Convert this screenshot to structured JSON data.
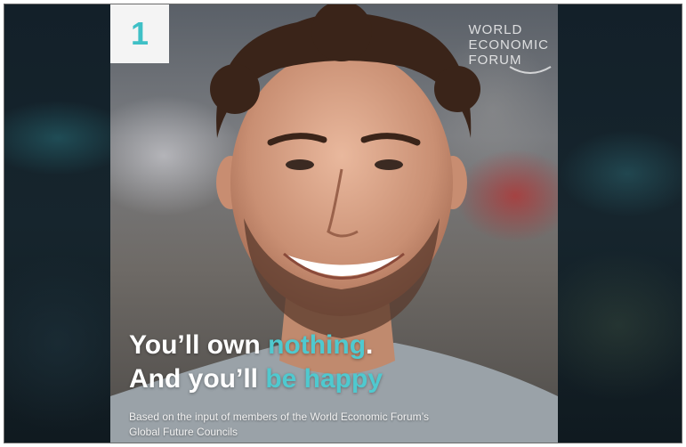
{
  "badge": {
    "number": "1"
  },
  "logo": {
    "line1": "WORLD",
    "line2": "ECONOMIC",
    "line3": "FORUM"
  },
  "headline": {
    "line1_part1": "You’ll own ",
    "line1_accent": "nothing",
    "line1_end": ".",
    "line2_part1": "And you’ll ",
    "line2_accent": "be happy"
  },
  "caption": {
    "line1": "Based on the input of members of the World Economic Forum’s",
    "line2": "Global Future Councils"
  },
  "colors": {
    "accent": "#4fc9cf",
    "badge_number": "#3fc0c6",
    "badge_bg": "#f4f4f4"
  }
}
